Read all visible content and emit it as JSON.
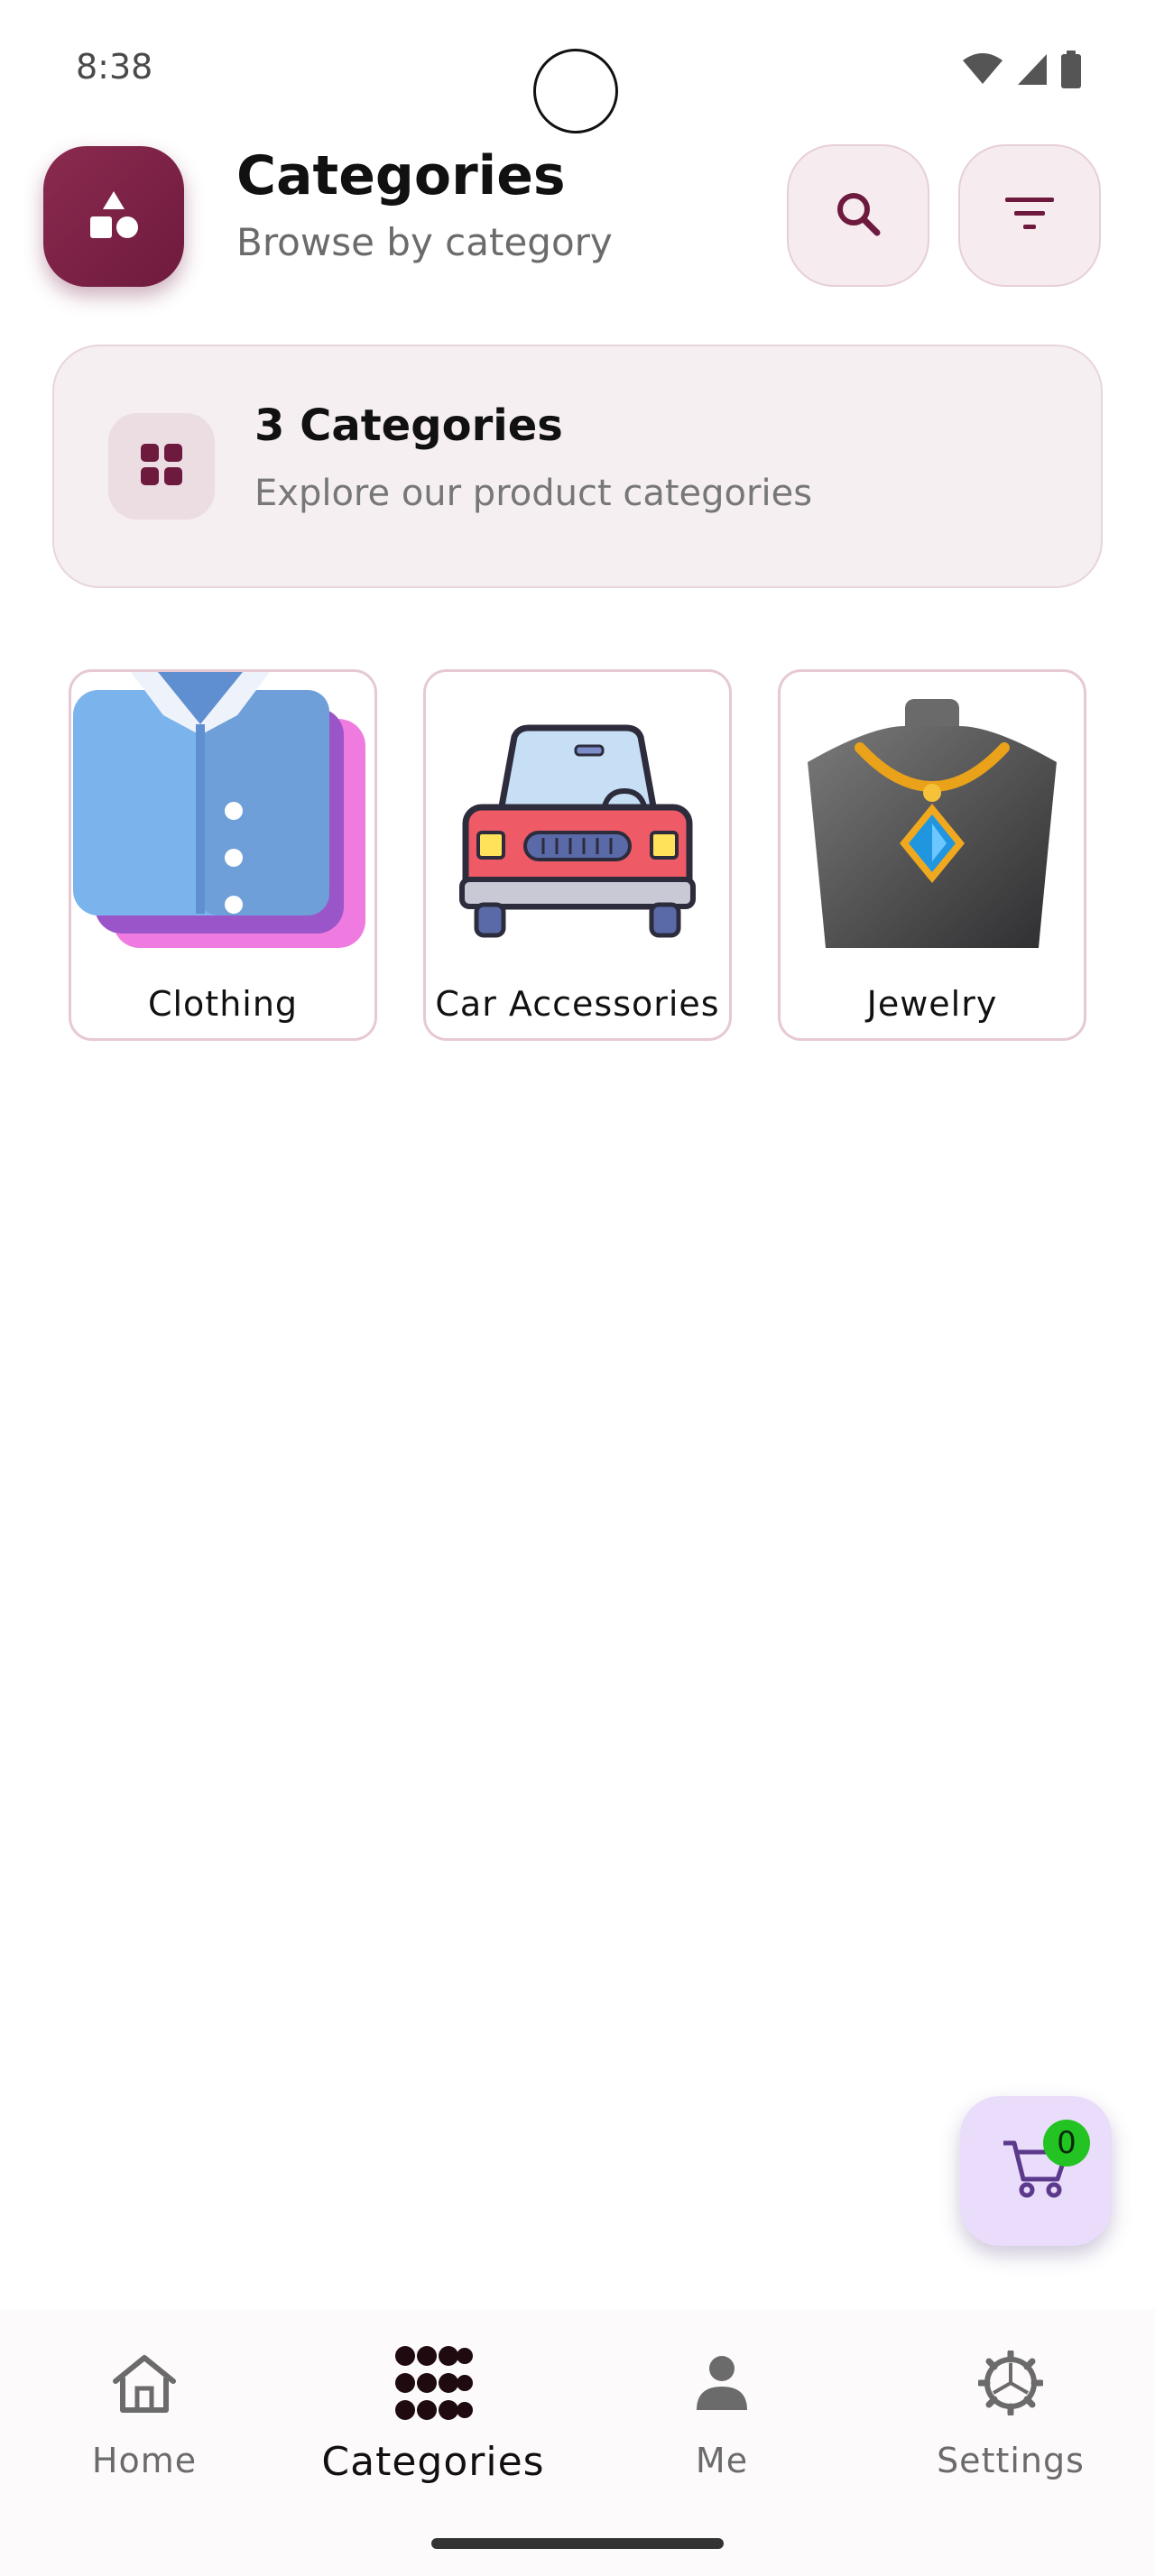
{
  "status_bar": {
    "time": "8:38",
    "icons": [
      "wifi-icon",
      "cell-signal-icon",
      "battery-icon"
    ]
  },
  "header": {
    "badge_icon": "shapes-icon",
    "title": "Categories",
    "subtitle": "Browse by category",
    "actions": [
      {
        "name": "search",
        "icon": "search-icon"
      },
      {
        "name": "filter",
        "icon": "filter-icon"
      }
    ]
  },
  "summary": {
    "icon": "grid-icon",
    "title": "3 Categories",
    "subtitle": "Explore our product categories"
  },
  "categories": [
    {
      "label": "Clothing",
      "image": "shirt-illustration"
    },
    {
      "label": "Car Accessories",
      "image": "car-illustration"
    },
    {
      "label": "Jewelry",
      "image": "necklace-illustration"
    }
  ],
  "cart": {
    "icon": "cart-icon",
    "count": "0"
  },
  "bottom_nav": {
    "active": "Categories",
    "items": [
      {
        "label": "Home",
        "icon": "home-icon"
      },
      {
        "label": "Categories",
        "icon": "categories-dots-icon"
      },
      {
        "label": "Me",
        "icon": "person-icon"
      },
      {
        "label": "Settings",
        "icon": "settings-icon"
      }
    ]
  },
  "colors": {
    "brand": "#7a2147",
    "surface_tint": "#f6ecef",
    "cart_fab": "#eadcfb",
    "badge_green": "#22c322"
  }
}
